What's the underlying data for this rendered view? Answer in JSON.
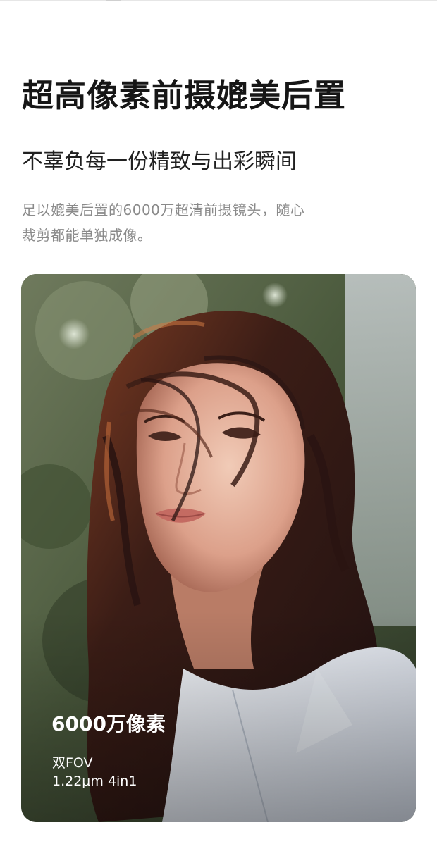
{
  "headline": "超高像素前摄媲美后置",
  "subheadline": "不辜负每一份精致与出彩瞬间",
  "description": {
    "line1": "足以媲美后置的6000万超清前摄镜头，随心",
    "line2": "裁剪都能单独成像。"
  },
  "photo": {
    "specs": {
      "megapixels": "6000万像素",
      "fov": "双FOV",
      "pixel": "1.22μm 4in1"
    }
  }
}
